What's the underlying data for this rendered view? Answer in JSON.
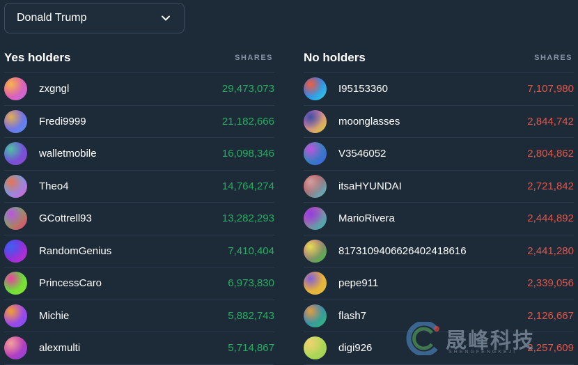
{
  "dropdown": {
    "selected": "Donald Trump"
  },
  "yes": {
    "title": "Yes holders",
    "shares_label": "SHARES",
    "rows": [
      {
        "name": "zxgngl",
        "shares": "29,473,073",
        "avatar": [
          "#f0548a",
          "#c86be0",
          "#f5b450"
        ]
      },
      {
        "name": "Fredi9999",
        "shares": "21,182,666",
        "avatar": [
          "#8a54e0",
          "#5a8ef0",
          "#e0b050"
        ]
      },
      {
        "name": "walletmobile",
        "shares": "16,098,346",
        "avatar": [
          "#5a5ae0",
          "#8a4ad0",
          "#50c0a0"
        ]
      },
      {
        "name": "Theo4",
        "shares": "14,764,274",
        "avatar": [
          "#30c0f0",
          "#e060d0",
          "#f07050"
        ]
      },
      {
        "name": "GCottrell93",
        "shares": "13,282,293",
        "avatar": [
          "#40e060",
          "#f04070",
          "#c050e0"
        ]
      },
      {
        "name": "RandomGenius",
        "shares": "7,410,404",
        "avatar": [
          "#6030e0",
          "#c030d0",
          "#4060f0"
        ]
      },
      {
        "name": "PrincessCaro",
        "shares": "6,973,830",
        "avatar": [
          "#40e040",
          "#90e030",
          "#f040a0"
        ]
      },
      {
        "name": "Michie",
        "shares": "5,882,743",
        "avatar": [
          "#c040e0",
          "#8050f0",
          "#f0a030"
        ]
      },
      {
        "name": "alexmulti",
        "shares": "5,714,867",
        "avatar": [
          "#e04090",
          "#9040e0",
          "#f0a0a0"
        ]
      }
    ]
  },
  "no": {
    "title": "No holders",
    "shares_label": "SHARES",
    "rows": [
      {
        "name": "I95153360",
        "shares": "7,107,980",
        "avatar": [
          "#3050f0",
          "#30d0e0",
          "#f06040"
        ]
      },
      {
        "name": "moonglasses",
        "shares": "2,844,742",
        "avatar": [
          "#c050e0",
          "#e0d030",
          "#4050a0"
        ]
      },
      {
        "name": "V3546052",
        "shares": "2,804,862",
        "avatar": [
          "#30a0a0",
          "#4060e0",
          "#c050e0"
        ]
      },
      {
        "name": "itsaHYUNDAI",
        "shares": "2,721,842",
        "avatar": [
          "#e03030",
          "#50c0d0",
          "#d0a0a0"
        ]
      },
      {
        "name": "MarioRivera",
        "shares": "2,444,892",
        "avatar": [
          "#e040a0",
          "#30c0b0",
          "#9040e0"
        ]
      },
      {
        "name": "817310940662640241861​6",
        "shares": "2,441,280",
        "avatar": [
          "#e050a0",
          "#40c040",
          "#e0e050"
        ]
      },
      {
        "name": "pepe911",
        "shares": "2,339,056",
        "avatar": [
          "#f0a030",
          "#e0c040",
          "#8060e0"
        ]
      },
      {
        "name": "flash7",
        "shares": "2,126,667",
        "avatar": [
          "#4060e0",
          "#30c070",
          "#e0a040"
        ]
      },
      {
        "name": "digi926",
        "shares": "2,257,609",
        "avatar": [
          "#c0e060",
          "#a0d050",
          "#f0d070"
        ]
      }
    ]
  },
  "watermark": {
    "text": "晟峰科技",
    "sub": "SHENGFENGKEJI"
  },
  "colors": {
    "background": "#1d2b39",
    "yes": "#27ae60",
    "no": "#e25548"
  }
}
